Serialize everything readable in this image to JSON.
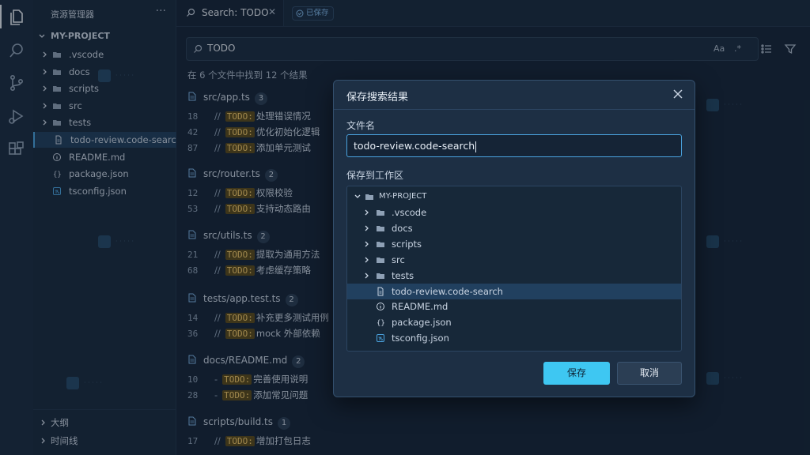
{
  "activity_bar": {
    "icons": [
      "files-icon",
      "search-icon",
      "source-control-icon",
      "run-debug-icon",
      "extensions-icon"
    ]
  },
  "explorer": {
    "title": "资源管理器",
    "more": "···",
    "project": "MY-PROJECT",
    "items": [
      {
        "label": ".vscode",
        "type": "folder"
      },
      {
        "label": "docs",
        "type": "folder"
      },
      {
        "label": "scripts",
        "type": "folder"
      },
      {
        "label": "src",
        "type": "folder"
      },
      {
        "label": "tests",
        "type": "folder"
      },
      {
        "label": "todo-review.code-search",
        "type": "file-search",
        "selected": true
      },
      {
        "label": "README.md",
        "type": "file-info"
      },
      {
        "label": "package.json",
        "type": "file-json"
      },
      {
        "label": "tsconfig.json",
        "type": "file-ts"
      }
    ],
    "outline": "大纲",
    "timeline": "时间线"
  },
  "tab": {
    "label": "Search: TODO",
    "close": "✕",
    "saved_badge": "已保存"
  },
  "search": {
    "query": "TODO",
    "match_case": "Aa",
    "regex": ".*",
    "summary": "在 6 个文件中找到 12 个结果"
  },
  "results": [
    {
      "file": "src/app.ts",
      "count": "3",
      "lines": [
        {
          "ln": "18",
          "pre": "//",
          "tag": "TODO:",
          "text": "处理错误情况"
        },
        {
          "ln": "42",
          "pre": "//",
          "tag": "TODO:",
          "text": "优化初始化逻辑"
        },
        {
          "ln": "87",
          "pre": "//",
          "tag": "TODO:",
          "text": "添加单元测试"
        }
      ]
    },
    {
      "file": "src/router.ts",
      "count": "2",
      "lines": [
        {
          "ln": "12",
          "pre": "//",
          "tag": "TODO:",
          "text": "权限校验"
        },
        {
          "ln": "53",
          "pre": "//",
          "tag": "TODO:",
          "text": "支持动态路由"
        }
      ]
    },
    {
      "file": "src/utils.ts",
      "count": "2",
      "lines": [
        {
          "ln": "21",
          "pre": "//",
          "tag": "TODO:",
          "text": "提取为通用方法"
        },
        {
          "ln": "68",
          "pre": "//",
          "tag": "TODO:",
          "text": "考虑缓存策略"
        }
      ]
    },
    {
      "file": "tests/app.test.ts",
      "count": "2",
      "lines": [
        {
          "ln": "14",
          "pre": "//",
          "tag": "TODO:",
          "text": "补充更多测试用例"
        },
        {
          "ln": "36",
          "pre": "//",
          "tag": "TODO:",
          "text": "mock 外部依赖"
        }
      ]
    },
    {
      "file": "docs/README.md",
      "count": "2",
      "lines": [
        {
          "ln": "10",
          "pre": "-",
          "tag": "TODO:",
          "text": "完善使用说明"
        },
        {
          "ln": "28",
          "pre": "-",
          "tag": "TODO:",
          "text": "添加常见问题"
        }
      ]
    },
    {
      "file": "scripts/build.ts",
      "count": "1",
      "lines": [
        {
          "ln": "17",
          "pre": "//",
          "tag": "TODO:",
          "text": "增加打包日志"
        }
      ]
    }
  ],
  "dialog": {
    "title": "保存搜索结果",
    "close": "✕",
    "filename_label": "文件名",
    "filename_value": "todo-review.code-search",
    "workspace_label": "保存到工作区",
    "project": "MY-PROJECT",
    "tree": [
      {
        "label": ".vscode",
        "type": "folder"
      },
      {
        "label": "docs",
        "type": "folder"
      },
      {
        "label": "scripts",
        "type": "folder"
      },
      {
        "label": "src",
        "type": "folder"
      },
      {
        "label": "tests",
        "type": "folder"
      },
      {
        "label": "todo-review.code-search",
        "type": "file-search",
        "selected": true
      },
      {
        "label": "README.md",
        "type": "file-info"
      },
      {
        "label": "package.json",
        "type": "file-json"
      },
      {
        "label": "tsconfig.json",
        "type": "file-ts"
      }
    ],
    "save_label": "保存",
    "cancel_label": "取消"
  },
  "colors": {
    "accent": "#3ec7f2",
    "highlight": "#f0c86a",
    "selection": "#21405f"
  }
}
